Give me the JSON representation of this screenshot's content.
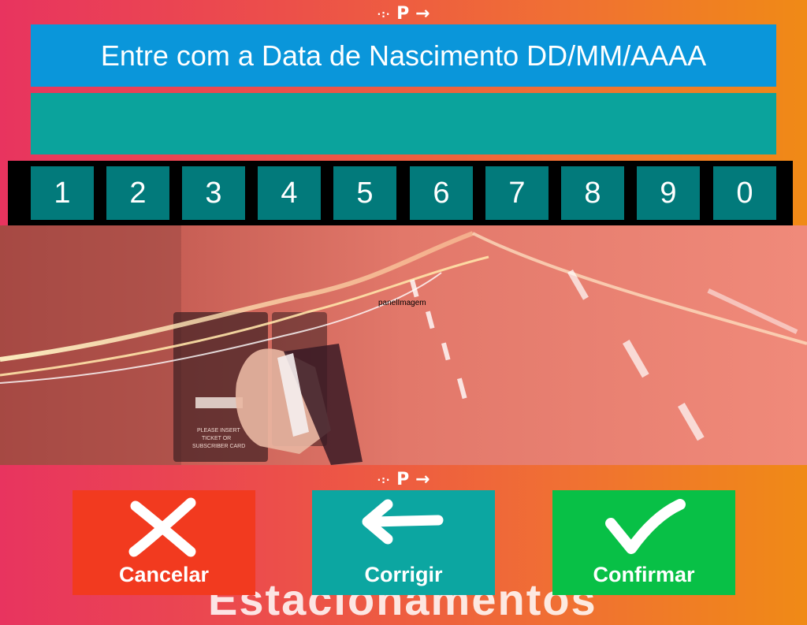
{
  "logo": {
    "mark": "P",
    "dots": "·:·",
    "arrow": "→"
  },
  "title": "Entre com a Data de Nascimento DD/MM/AAAA",
  "input_value": "",
  "keypad": [
    "1",
    "2",
    "3",
    "4",
    "5",
    "6",
    "7",
    "8",
    "9",
    "0"
  ],
  "panel": {
    "label": "panelImagem"
  },
  "buttons": {
    "cancel": {
      "label": "Cancelar",
      "icon": "close-icon"
    },
    "fix": {
      "label": "Corrigir",
      "icon": "arrow-left-icon"
    },
    "confirm": {
      "label": "Confirmar",
      "icon": "checkmark-icon"
    }
  },
  "watermark": "Estacionamentos",
  "colors": {
    "title_bg": "#0a96da",
    "display_bg": "#0ba39c",
    "key_bg": "#027a7b",
    "cancel_bg": "#f23a1f",
    "fix_bg": "#0ca6a1",
    "confirm_bg": "#08c046"
  }
}
